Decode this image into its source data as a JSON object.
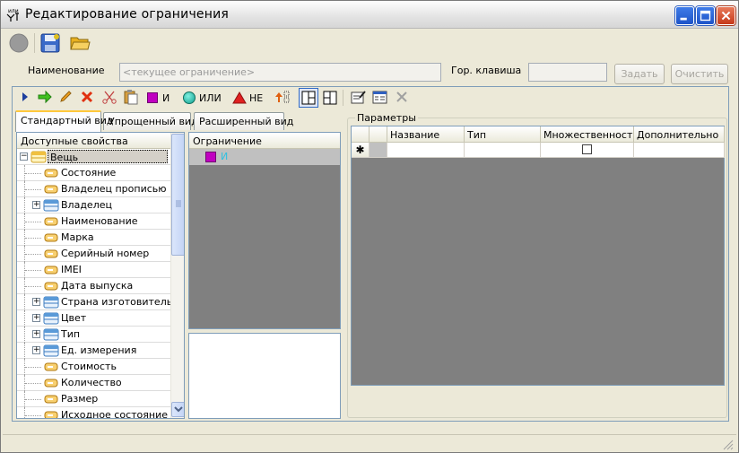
{
  "window": {
    "title": "Редактирование  ограничения",
    "app_icon_text": "или"
  },
  "name_row": {
    "name_label": "Наименование",
    "name_placeholder": "<текущее ограничение>",
    "hotkey_label": "Гор. клавиша",
    "hotkey_value": "",
    "assign_button": "Задать",
    "clear_button": "Очистить"
  },
  "expression_toolbar": {
    "and_label": "И",
    "or_label": "ИЛИ",
    "not_label": "НЕ"
  },
  "tabs": [
    {
      "label": "Стандартный вид",
      "active": true
    },
    {
      "label": "Упрощенный вид",
      "active": false
    },
    {
      "label": "Расширенный вид",
      "active": false
    }
  ],
  "tree": {
    "header": "Доступные свойства",
    "root": "Вещь",
    "items": [
      {
        "label": "Состояние",
        "type": "field",
        "expandable": false
      },
      {
        "label": "Владелец прописью",
        "type": "field",
        "expandable": false
      },
      {
        "label": "Владелец",
        "type": "table",
        "expandable": true
      },
      {
        "label": "Наименование",
        "type": "field",
        "expandable": false
      },
      {
        "label": "Марка",
        "type": "field",
        "expandable": false
      },
      {
        "label": "Серийный номер",
        "type": "field",
        "expandable": false
      },
      {
        "label": "IMEI",
        "type": "field",
        "expandable": false
      },
      {
        "label": "Дата выпуска",
        "type": "field",
        "expandable": false
      },
      {
        "label": "Страна изготовитель",
        "type": "table",
        "expandable": true
      },
      {
        "label": "Цвет",
        "type": "table",
        "expandable": true
      },
      {
        "label": "Тип",
        "type": "table",
        "expandable": true
      },
      {
        "label": "Ед. измерения",
        "type": "table",
        "expandable": true
      },
      {
        "label": "Стоимость",
        "type": "field",
        "expandable": false
      },
      {
        "label": "Количество",
        "type": "field",
        "expandable": false
      },
      {
        "label": "Размер",
        "type": "field",
        "expandable": false
      },
      {
        "label": "Исходное состояние",
        "type": "field",
        "expandable": false
      }
    ]
  },
  "constraint": {
    "header": "Ограничение",
    "node_label": "И"
  },
  "params": {
    "legend": "Параметры",
    "columns": [
      "Название",
      "Тип",
      "Множественность",
      "Дополнительно"
    ],
    "new_row_marker": "✱"
  },
  "colors": {
    "and_purple": "#c000c0",
    "or_teal": "#20b0a0",
    "not_red": "#e02020",
    "tree_selected": "#d4d0c8",
    "grid_bg": "#808080"
  }
}
